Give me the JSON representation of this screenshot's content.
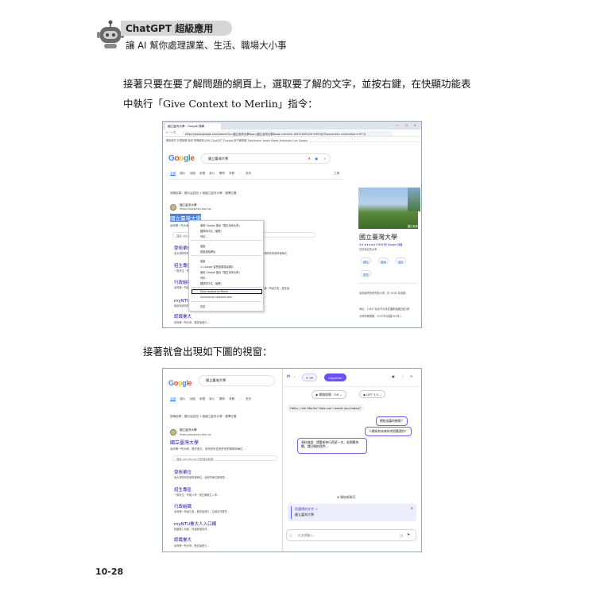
{
  "header": {
    "title": "ChatGPT 超級應用",
    "subtitle": "讓 AI 幫你處理課業、生活、職場大小事"
  },
  "body": {
    "paragraph_1": "接著只要在要了解問題的網頁上，選取要了解的文字，並按右鍵，在快顯功能表中執行「Give Context to Merlin」指令：",
    "paragraph_2": "接著就會出現如下圖的視窗：",
    "page_number": "10-28"
  },
  "shot1": {
    "tab_title": "國立臺灣大學 - Google 搜尋",
    "window_controls": "— ☐ ✕",
    "url": "https://www.google.com/search?q=國立臺灣大學&oq=國立臺灣大學&aqs=chrome..69i57j0i512l9.5397j0j7&sourceid=chrome&ie=UTF-8",
    "bookmarks": "應用程式   社群媒體   參考   電腦維護   APIS   ChatGPT   Threads   電子報相關   Typeformer   Yoastr   Power Automate   Link   Google",
    "logo": [
      "G",
      "o",
      "o",
      "g",
      "l",
      "e"
    ],
    "search_query": "國立臺灣大學",
    "tabs": [
      "全部",
      "圖片",
      "地圖",
      "新聞",
      "影片",
      "購物",
      "書籍",
      "⋮ 更多",
      "工具"
    ],
    "spelling_note": "搜尋結果：顯示這四回 1 個國立臺灣大學 · 選擇位置",
    "result_site": "國立臺灣大學",
    "result_url": "https://www.ntu.edu.tw",
    "result_title": "國立臺灣大學",
    "result_snippet": "臺灣第一所大學，歷史悠久，設有院系並有許多附屬學術單位...",
    "site_search_placeholder": "搜尋 ntu.edu.tw",
    "sitelinks": [
      {
        "title": "學術單位",
        "desc": "臺大學院系所與學程單位"
      },
      {
        "title": "招生專區",
        "desc": "一般考生 · 外籍入學 · 僑生..."
      },
      {
        "title": "行政組織",
        "desc": "臺灣第一所最古老，歷史最悠久..."
      },
      {
        "title": "myNTU臺大人入口網",
        "desc": "個臺系統資訊..."
      },
      {
        "title": "認識臺大",
        "desc": "臺灣第一所大學，歷史最悠久..."
      }
    ],
    "context_menu": [
      "使用 Google 搜尋「國立臺灣大學」",
      "翻譯成中文（繁體）",
      "複製",
      "複製連結網址",
      "列印...",
      "以 Google 智慧鏡頭搜尋圖片",
      "檢查",
      "Give context to Merlin",
      "Summarize selected text",
      "檢查"
    ],
    "context_menu_highlight": "Give context to Merlin",
    "knowledge_panel": {
      "photo_label": "圖片來源",
      "title": "國立臺灣大學",
      "rating": "4.6 ★★★★★ 5,659 則 Google 評論",
      "type": "位於臺北的大學",
      "buttons": [
        "網站",
        "路線",
        "儲存",
        "撥號"
      ],
      "desc": "臺灣最早的研究型大學，於 1928 年創辦...",
      "address": "地址：10617台北市大安區羅斯福路四段1號",
      "founded": "大學學費概要：2015年(民國104年)..."
    }
  },
  "shot2": {
    "search_query": "國立臺灣大學",
    "tabs": [
      "全部",
      "圖片",
      "地圖",
      "新聞",
      "影片",
      "購物",
      "書籍",
      "⋮ 更多"
    ],
    "spelling_note": "搜尋結果：顯示這四回 1 個國立臺灣大學 · 選擇位置",
    "result_site": "國立臺灣大學",
    "result_url": "https://www.ntu.edu.tw",
    "result_title": "國立臺灣大學",
    "result_snippet": "臺灣第一所大學，歷史悠久，設有院系並有許多附屬學術單位...",
    "site_search_placeholder": "搜尋 ntu.edu.tw 內的搜尋結果",
    "sitelinks": [
      {
        "title": "學術單位",
        "desc": "臺大學院系所與學程單位，含研究單位與學院..."
      },
      {
        "title": "招生專區",
        "desc": "一般考生 · 外籍入學 · 僑生與陸生入學..."
      },
      {
        "title": "行政組織",
        "desc": "臺灣第一所最古老，歷史最悠久，且最具代表性..."
      },
      {
        "title": "myNTU臺大人入口網",
        "desc": "校園登入系統，快速連接資訊..."
      },
      {
        "title": "認識臺大",
        "desc": "臺灣第一所大學，歷史最悠久..."
      }
    ],
    "merlin": {
      "model_icon": "M",
      "credits": "99",
      "upgrade": "Upgrade!",
      "web_access": "網路搜尋：Off",
      "model": "GPT 3.5",
      "greeting": "Hello, I am Merlin! How can I assist you today?",
      "suggestions": [
        "總結這篇的網頁？",
        "人類如何未來如何對應運作？"
      ],
      "bot_reply": "資料錯誤：請重新執行再試一次，若問題持續，請回報給我們...",
      "new_chat": "開始新聊天",
      "context_label": "您選擇的文字 →",
      "context_text": "國立臺灣大學",
      "input_placeholder": "在這裡輸入...",
      "send_icon": "send-icon"
    }
  }
}
